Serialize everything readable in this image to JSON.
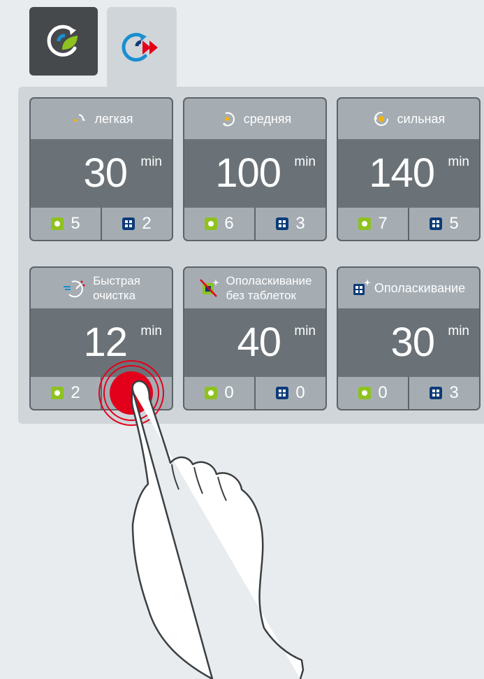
{
  "tabs": [
    {
      "id": "eco",
      "icon": "eco-leaf-icon",
      "active": false
    },
    {
      "id": "express",
      "icon": "fast-forward-icon",
      "active": true
    }
  ],
  "programs": [
    {
      "label": "легкая",
      "icon": "light-wash-icon",
      "minutes": "30",
      "unit": "min",
      "count_green": "5",
      "count_blue": "2"
    },
    {
      "label": "средняя",
      "icon": "medium-wash-icon",
      "minutes": "100",
      "unit": "min",
      "count_green": "6",
      "count_blue": "3"
    },
    {
      "label": "сильная",
      "icon": "strong-wash-icon",
      "minutes": "140",
      "unit": "min",
      "count_green": "7",
      "count_blue": "5"
    },
    {
      "label_line1": "Быстрая",
      "label_line2": "очистка",
      "icon": "quick-clean-icon",
      "minutes": "12",
      "unit": "min",
      "count_green": "2",
      "count_blue": ""
    },
    {
      "label_line1": "Ополаскивание",
      "label_line2": "без таблеток",
      "icon": "rinse-no-tablets-icon",
      "minutes": "40",
      "unit": "min",
      "count_green": "0",
      "count_blue": "0"
    },
    {
      "label": "Ополаскивание",
      "icon": "rinse-icon",
      "minutes": "30",
      "unit": "min",
      "count_green": "0",
      "count_blue": "3"
    }
  ],
  "colors": {
    "accent_green": "#8ec21f",
    "accent_blue": "#0d3b78",
    "touch_red": "#e2001a",
    "card_dark": "#6a7277",
    "card_light": "#a5adb3"
  }
}
